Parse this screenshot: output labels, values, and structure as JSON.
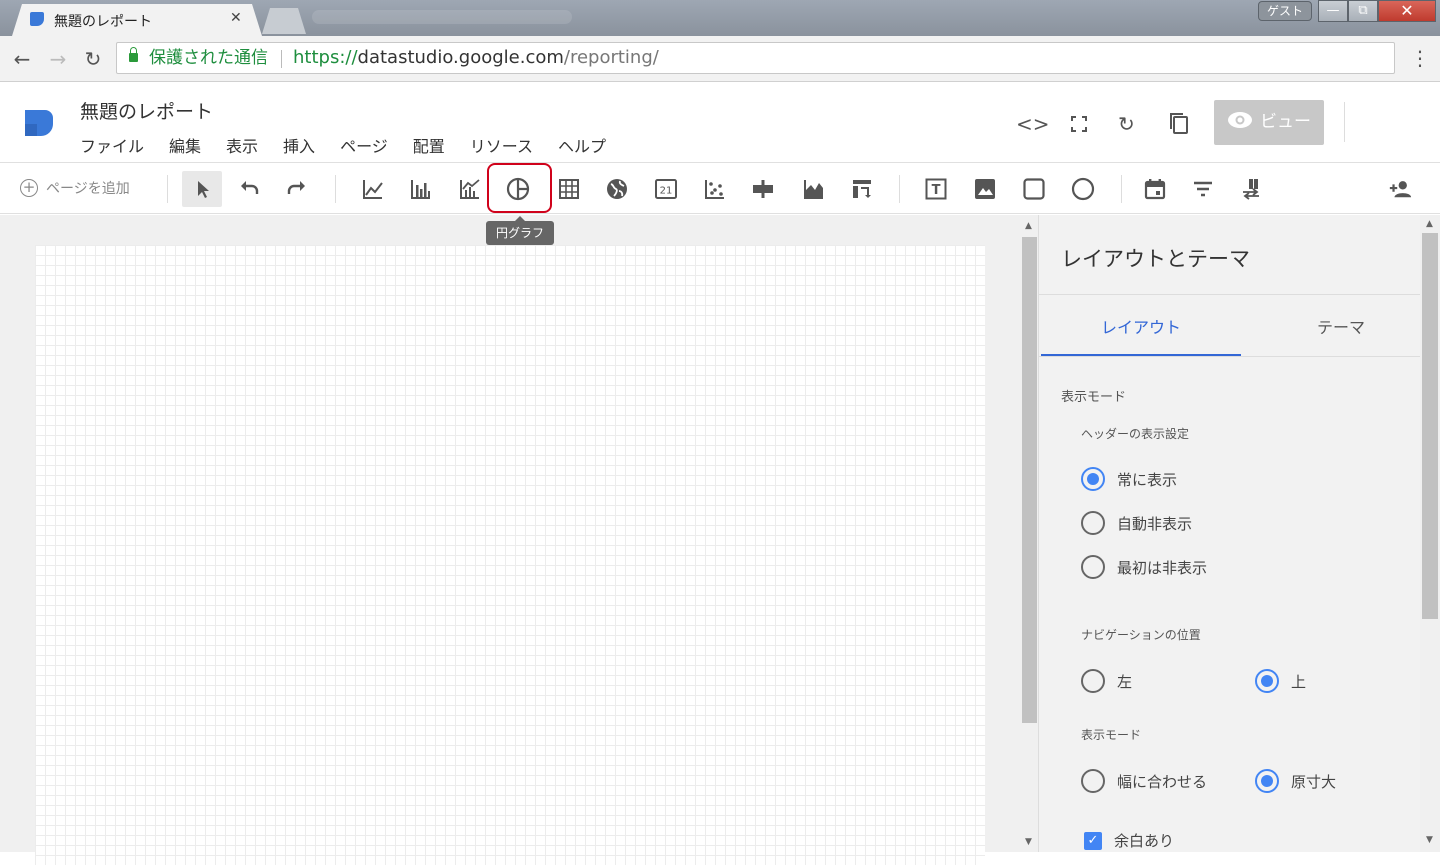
{
  "browser": {
    "tab_title": "無題のレポート",
    "tab_close": "✕",
    "guest_label": "ゲスト",
    "secure_label": "保護された通信",
    "url_scheme": "https://",
    "url_host": "datastudio.google.com",
    "url_path": "/reporting/"
  },
  "app": {
    "title": "無題のレポート",
    "menu": [
      "ファイル",
      "編集",
      "表示",
      "挿入",
      "ページ",
      "配置",
      "リソース",
      "ヘルプ"
    ],
    "view_button": "ビュー",
    "brand_color": "#3a79d8",
    "accent_color": "#4285f4"
  },
  "toolbar": {
    "add_page": "ページを追加",
    "tooltip": "円グラフ",
    "scorecard_glyph": "21",
    "text_glyph": "T",
    "highlight_color": "#d0021b"
  },
  "panel": {
    "title": "レイアウトとテーマ",
    "tabs": [
      "レイアウト",
      "テーマ"
    ],
    "display_mode_section": "表示モード",
    "header_setting_label": "ヘッダーの表示設定",
    "header_options": [
      "常に表示",
      "自動非表示",
      "最初は非表示"
    ],
    "nav_position_label": "ナビゲーションの位置",
    "nav_options": [
      "左",
      "上"
    ],
    "display_mode_label": "表示モード",
    "display_mode_options": [
      "幅に合わせる",
      "原寸大"
    ],
    "margin_label": "余白あり"
  }
}
